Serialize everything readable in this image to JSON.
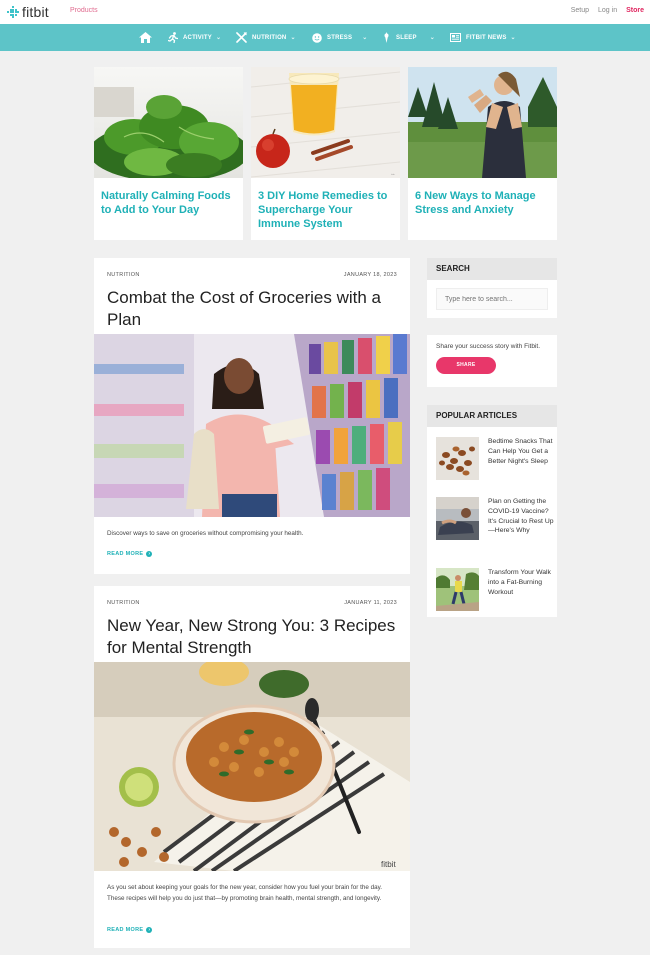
{
  "topbar": {
    "logo": "fitbit",
    "products": "Products",
    "setup": "Setup",
    "login": "Log in",
    "store": "Store"
  },
  "nav": {
    "items": [
      {
        "label": "",
        "icon": "home-icon"
      },
      {
        "label": "ACTIVITY",
        "icon": "running-icon"
      },
      {
        "label": "NUTRITION",
        "icon": "utensils-icon"
      },
      {
        "label": "STRESS",
        "icon": "smile-icon"
      },
      {
        "label": "SLEEP",
        "icon": "moon-icon"
      },
      {
        "label": "FITBIT NEWS",
        "icon": "newspaper-icon"
      }
    ]
  },
  "featured": [
    {
      "title": "Naturally Calming Foods to Add to Your Day"
    },
    {
      "title": "3 DIY Home Remedies to Supercharge Your Immune System"
    },
    {
      "title": "6 New Ways to Manage Stress and Anxiety"
    }
  ],
  "articles": [
    {
      "category": "NUTRITION",
      "date": "JANUARY 18, 2023",
      "title": "Combat the Cost of Groceries with a Plan",
      "description": "Discover ways to save on groceries without compromising your health.",
      "read_more": "READ MORE"
    },
    {
      "category": "NUTRITION",
      "date": "JANUARY 11, 2023",
      "title": "New Year, New Strong You: 3 Recipes for Mental Strength",
      "description": "As you set about keeping your goals for the new year, consider how you fuel your brain for the day. These recipes will help you do just that—by promoting brain health, mental strength, and longevity.",
      "read_more": "READ MORE",
      "watermark": "fitbit"
    }
  ],
  "sidebar": {
    "search": {
      "heading": "SEARCH",
      "placeholder": "Type here to search..."
    },
    "share": {
      "text": "Share your success story with Fitbit.",
      "button": "SHARE"
    },
    "popular": {
      "heading": "POPULAR ARTICLES",
      "items": [
        {
          "title": "Bedtime Snacks That Can Help You Get a Better Night's Sleep"
        },
        {
          "title": "Plan on Getting the COVID-19 Vaccine? It's Crucial to Rest Up—Here's Why"
        },
        {
          "title": "Transform Your Walk into a Fat-Burning Workout"
        }
      ]
    }
  },
  "colors": {
    "teal": "#5dc4c8",
    "link": "#1fb1b7",
    "pink": "#e8376a"
  }
}
